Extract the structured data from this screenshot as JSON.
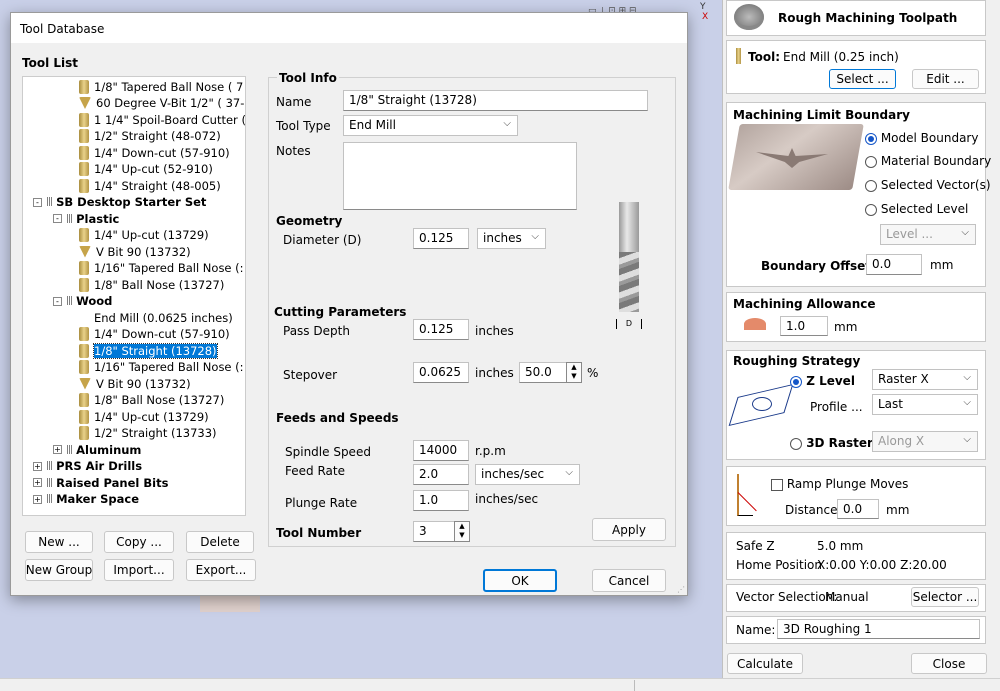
{
  "dialog": {
    "title": "Tool Database",
    "tool_list_label": "Tool List"
  },
  "tree": [
    {
      "text": "1/8\" Tapered Ball Nose ( 7",
      "icon": "drill-bit-icon"
    },
    {
      "text": "60 Degree V-Bit 1/2\" ( 37-",
      "icon": "vbit-icon"
    },
    {
      "text": "1 1/4\" Spoil-Board Cutter (",
      "icon": "drill-bit-icon"
    },
    {
      "text": "1/2\" Straight  (48-072)",
      "icon": "drill-bit-icon"
    },
    {
      "text": "1/4\"  Down-cut (57-910)",
      "icon": "drill-bit-icon"
    },
    {
      "text": "1/4\" Up-cut (52-910)",
      "icon": "drill-bit-icon"
    },
    {
      "text": "1/4\" Straight  (48-005)",
      "icon": "drill-bit-icon"
    },
    {
      "text": "SB Desktop Starter Set",
      "group": true
    },
    {
      "text": "Plastic",
      "group": true
    },
    {
      "text": "1/4\" Up-cut (13729)",
      "icon": "drill-bit-icon"
    },
    {
      "text": "V Bit 90 (13732)",
      "icon": "vbit-icon"
    },
    {
      "text": "1/16\" Tapered Ball Nose (:",
      "icon": "drill-bit-icon"
    },
    {
      "text": "1/8\" Ball Nose (13727)",
      "icon": "drill-bit-icon"
    },
    {
      "text": "Wood",
      "group": true
    },
    {
      "text": "End Mill (0.0625 inches)",
      "icon": "none"
    },
    {
      "text": "1/4\"  Down-cut (57-910)",
      "icon": "drill-bit-icon"
    },
    {
      "text": "1/8\" Straight (13728)",
      "icon": "drill-bit-icon",
      "selected": true
    },
    {
      "text": "1/16\" Tapered Ball Nose (:",
      "icon": "drill-bit-icon"
    },
    {
      "text": "V Bit 90 (13732)",
      "icon": "vbit-icon"
    },
    {
      "text": "1/8\" Ball Nose (13727)",
      "icon": "drill-bit-icon"
    },
    {
      "text": "1/4\" Up-cut (13729)",
      "icon": "drill-bit-icon"
    },
    {
      "text": "1/2\" Straight (13733)",
      "icon": "drill-bit-icon"
    },
    {
      "text": "Aluminum",
      "group": true
    },
    {
      "text": "PRS Air Drills",
      "group": true
    },
    {
      "text": "Raised Panel Bits",
      "group": true
    },
    {
      "text": "Maker Space",
      "group": true
    }
  ],
  "list_buttons": {
    "new": "New ...",
    "copy": "Copy ...",
    "delete": "Delete",
    "new_group": "New Group",
    "import": "Import...",
    "export": "Export..."
  },
  "tool_info": {
    "heading": "Tool Info",
    "name_label": "Name",
    "name_value": "1/8\" Straight (13728)",
    "type_label": "Tool Type",
    "type_value": "End Mill",
    "notes_label": "Notes",
    "notes_value": ""
  },
  "geometry": {
    "heading": "Geometry",
    "diameter_label": "Diameter (D)",
    "diameter_value": "0.125",
    "units": "inches",
    "d_marker": "D"
  },
  "cutting": {
    "heading": "Cutting Parameters",
    "pass_depth_label": "Pass Depth",
    "pass_depth_value": "0.125",
    "pass_depth_units": "inches",
    "stepover_label": "Stepover",
    "stepover_value": "0.0625",
    "stepover_units": "inches",
    "stepover_pct": "50.0",
    "pct_sign": "%"
  },
  "feeds": {
    "heading": "Feeds and Speeds",
    "spindle_label": "Spindle Speed",
    "spindle_value": "14000",
    "spindle_units": "r.p.m",
    "feed_label": "Feed Rate",
    "feed_value": "2.0",
    "feed_units": "inches/sec",
    "plunge_label": "Plunge Rate",
    "plunge_value": "1.0",
    "plunge_units": "inches/sec"
  },
  "tool_number": {
    "label": "Tool Number",
    "value": "3"
  },
  "dialog_buttons": {
    "apply": "Apply",
    "ok": "OK",
    "cancel": "Cancel"
  },
  "panel": {
    "title": "Rough Machining Toolpath",
    "tool_label": "Tool:",
    "tool_value": "End Mill (0.25 inch)",
    "select": "Select ...",
    "edit": "Edit ...",
    "boundary_heading": "Machining Limit Boundary",
    "model_boundary": "Model Boundary",
    "material_boundary": "Material Boundary",
    "selected_vectors": "Selected Vector(s)",
    "selected_level": "Selected Level",
    "level_select": "Level ...",
    "boundary_offset_label": "Boundary Offset",
    "boundary_offset_value": "0.0",
    "boundary_offset_units": "mm",
    "allowance_heading": "Machining Allowance",
    "allowance_value": "1.0",
    "allowance_units": "mm",
    "strategy_heading": "Roughing Strategy",
    "z_level": "Z Level",
    "z_level_value": "Raster X",
    "profile_label": "Profile ...",
    "profile_value": "Last",
    "raster_3d": "3D Raster",
    "raster_3d_value": "Along X",
    "ramp_label": "Ramp Plunge Moves",
    "distance_label": "Distance",
    "distance_value": "0.0",
    "distance_units": "mm",
    "safe_z_label": "Safe Z",
    "safe_z_value": "5.0 mm",
    "home_label": "Home Position",
    "home_value": "X:0.00 Y:0.00 Z:20.00",
    "vector_selection_label": "Vector Selection:",
    "vector_selection_value": "Manual",
    "selector": "Selector ...",
    "name_label": "Name:",
    "name_value": "3D Roughing 1",
    "calculate": "Calculate",
    "close": "Close"
  },
  "axis": {
    "y": "Y",
    "x": "X"
  },
  "colors": {
    "selection": "#0078d7",
    "radio_accent": "#1456c8",
    "background": "#c9d0e8"
  }
}
